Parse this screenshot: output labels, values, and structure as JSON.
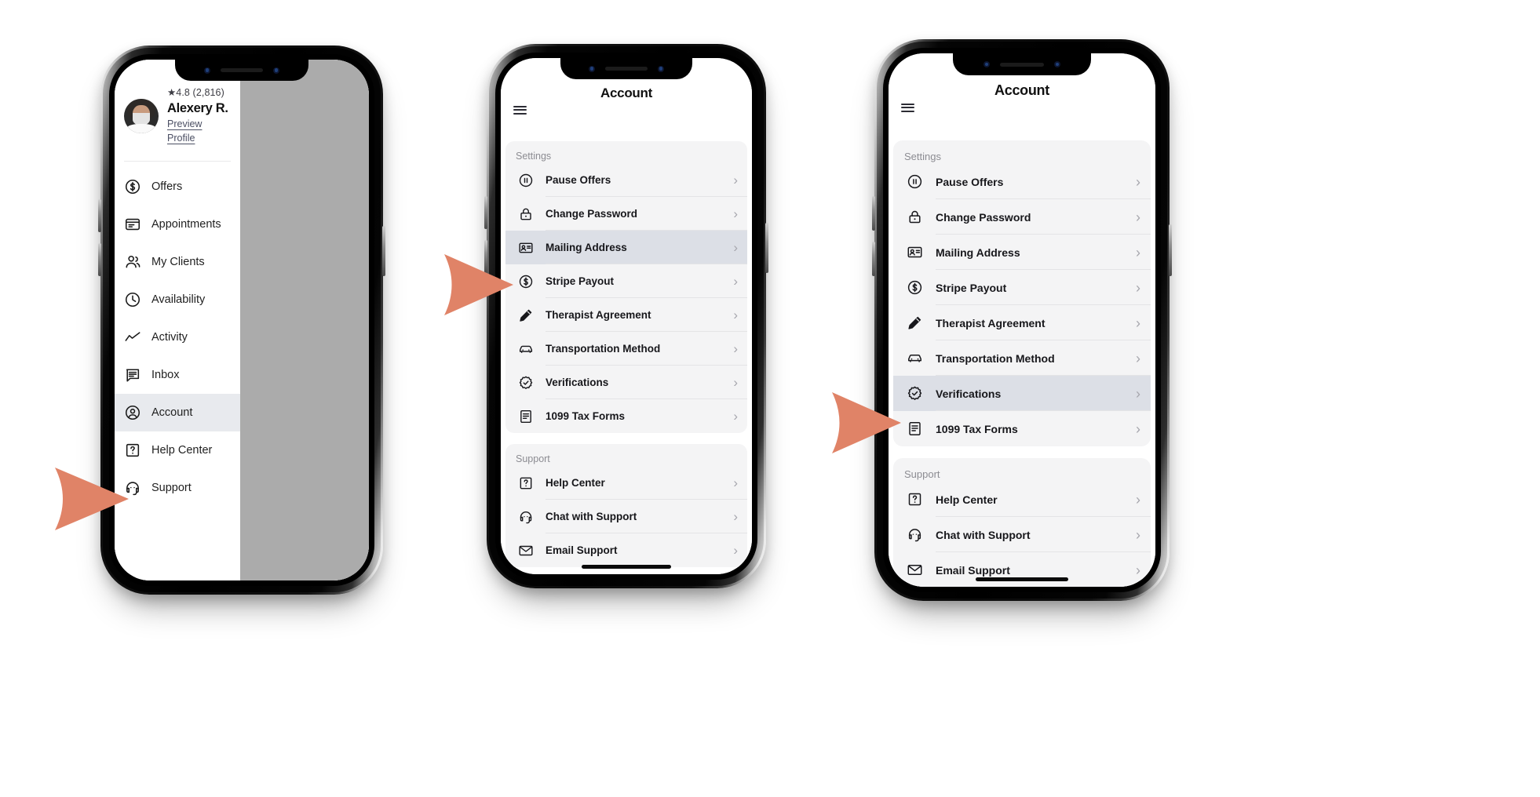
{
  "meta": {
    "accent_arrow_color": "#e08367",
    "scrim_color": "#ababab",
    "card_bg": "#f4f4f5",
    "selected_row_bg_drawer": "#e8eaee",
    "selected_row_bg_list": "#dcdfe6"
  },
  "phone1": {
    "profile": {
      "rating": "★4.8 (2,816)",
      "name": "Alexery R.",
      "preview_link": "Preview Profile",
      "avatar_name": "user-avatar"
    },
    "nav_items": [
      {
        "label": "Offers",
        "icon": "dollar-circle-icon",
        "selected": false
      },
      {
        "label": "Appointments",
        "icon": "calendar-card-icon",
        "selected": false
      },
      {
        "label": "My Clients",
        "icon": "people-icon",
        "selected": false
      },
      {
        "label": "Availability",
        "icon": "clock-icon",
        "selected": false
      },
      {
        "label": "Activity",
        "icon": "trend-line-icon",
        "selected": false
      },
      {
        "label": "Inbox",
        "icon": "chat-lines-icon",
        "selected": false
      },
      {
        "label": "Account",
        "icon": "user-circle-icon",
        "selected": true
      },
      {
        "label": "Help Center",
        "icon": "question-box-icon",
        "selected": false
      },
      {
        "label": "Support",
        "icon": "headset-icon",
        "selected": false
      }
    ]
  },
  "phone2": {
    "topbar": {
      "title": "Account",
      "menu_icon": "hamburger-menu-icon"
    },
    "settings": {
      "label": "Settings",
      "items": [
        {
          "label": "Pause Offers",
          "icon": "pause-circle-icon",
          "selected": false,
          "chevron": "›"
        },
        {
          "label": "Change Password",
          "icon": "lock-icon",
          "selected": false,
          "chevron": "›"
        },
        {
          "label": "Mailing Address",
          "icon": "id-card-icon",
          "selected": true,
          "chevron": "›"
        },
        {
          "label": "Stripe Payout",
          "icon": "dollar-circle-icon",
          "selected": false,
          "chevron": "›"
        },
        {
          "label": "Therapist Agreement",
          "icon": "pencil-icon",
          "selected": false,
          "chevron": "›"
        },
        {
          "label": "Transportation Method",
          "icon": "car-icon",
          "selected": false,
          "chevron": "›"
        },
        {
          "label": "Verifications",
          "icon": "verified-badge-icon",
          "selected": false,
          "chevron": "›"
        },
        {
          "label": "1099 Tax Forms",
          "icon": "document-icon",
          "selected": false,
          "chevron": "›"
        }
      ]
    },
    "support": {
      "label": "Support",
      "items": [
        {
          "label": "Help Center",
          "icon": "question-box-icon",
          "selected": false,
          "chevron": "›"
        },
        {
          "label": "Chat with Support",
          "icon": "headset-icon",
          "selected": false,
          "chevron": "›"
        },
        {
          "label": "Email Support",
          "icon": "envelope-icon",
          "selected": false,
          "chevron": "›"
        }
      ]
    }
  },
  "phone3": {
    "topbar": {
      "title": "Account",
      "menu_icon": "hamburger-menu-icon"
    },
    "settings": {
      "label": "Settings",
      "items": [
        {
          "label": "Pause Offers",
          "icon": "pause-circle-icon",
          "selected": false,
          "chevron": "›"
        },
        {
          "label": "Change Password",
          "icon": "lock-icon",
          "selected": false,
          "chevron": "›"
        },
        {
          "label": "Mailing Address",
          "icon": "id-card-icon",
          "selected": false,
          "chevron": "›"
        },
        {
          "label": "Stripe Payout",
          "icon": "dollar-circle-icon",
          "selected": false,
          "chevron": "›"
        },
        {
          "label": "Therapist Agreement",
          "icon": "pencil-icon",
          "selected": false,
          "chevron": "›"
        },
        {
          "label": "Transportation Method",
          "icon": "car-icon",
          "selected": false,
          "chevron": "›"
        },
        {
          "label": "Verifications",
          "icon": "verified-badge-icon",
          "selected": true,
          "chevron": "›"
        },
        {
          "label": "1099 Tax Forms",
          "icon": "document-icon",
          "selected": false,
          "chevron": "›"
        }
      ]
    },
    "support": {
      "label": "Support",
      "items": [
        {
          "label": "Help Center",
          "icon": "question-box-icon",
          "selected": false,
          "chevron": "›"
        },
        {
          "label": "Chat with Support",
          "icon": "headset-icon",
          "selected": false,
          "chevron": "›"
        },
        {
          "label": "Email Support",
          "icon": "envelope-icon",
          "selected": false,
          "chevron": "›"
        }
      ]
    }
  },
  "annotations": {
    "arrows": [
      {
        "name": "arrow-to-account-menu-item"
      },
      {
        "name": "arrow-to-mailing-address-row"
      },
      {
        "name": "arrow-to-verifications-row"
      }
    ]
  }
}
